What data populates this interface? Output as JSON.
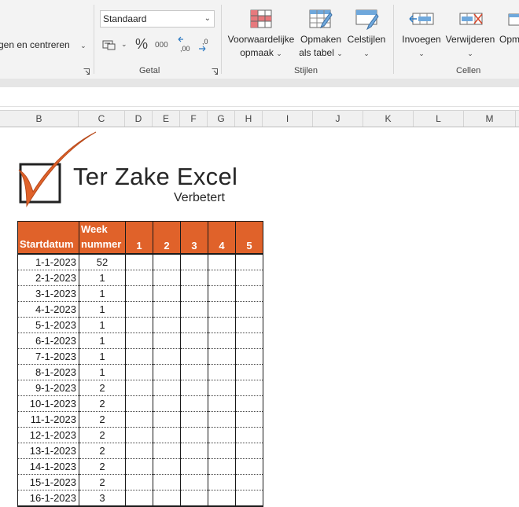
{
  "ribbon": {
    "alignment_partial_label": "gen en centreren",
    "number_format_value": "Standaard",
    "groups": {
      "getal": "Getal",
      "stijlen": "Stijlen",
      "cellen": "Cellen"
    },
    "buttons": {
      "voorwaardelijke_line1": "Voorwaardelijke",
      "voorwaardelijke_line2": "opmaak",
      "opmaken_line1": "Opmaken",
      "opmaken_line2": "als tabel",
      "celstijlen": "Celstijlen",
      "invoegen": "Invoegen",
      "verwijderen": "Verwijderen",
      "opmaak_partial": "Opm"
    },
    "number_symbols": {
      "percent": "%",
      "thousands": "000",
      "inc_decimal": ",00",
      "dec_decimal": ",0"
    }
  },
  "columns": [
    "B",
    "C",
    "D",
    "E",
    "F",
    "G",
    "H",
    "I",
    "J",
    "K",
    "L",
    "M"
  ],
  "logo": {
    "title": "Ter Zake Excel",
    "subtitle": "Verbetert"
  },
  "table": {
    "headers": {
      "startdatum": "Startdatum",
      "week_line1": "Week",
      "week_line2": "nummer",
      "days": [
        "1",
        "2",
        "3",
        "4",
        "5"
      ]
    },
    "rows": [
      {
        "date": "1-1-2023",
        "week": "52"
      },
      {
        "date": "2-1-2023",
        "week": "1"
      },
      {
        "date": "3-1-2023",
        "week": "1"
      },
      {
        "date": "4-1-2023",
        "week": "1"
      },
      {
        "date": "5-1-2023",
        "week": "1"
      },
      {
        "date": "6-1-2023",
        "week": "1"
      },
      {
        "date": "7-1-2023",
        "week": "1"
      },
      {
        "date": "8-1-2023",
        "week": "1"
      },
      {
        "date": "9-1-2023",
        "week": "2"
      },
      {
        "date": "10-1-2023",
        "week": "2"
      },
      {
        "date": "11-1-2023",
        "week": "2"
      },
      {
        "date": "12-1-2023",
        "week": "2"
      },
      {
        "date": "13-1-2023",
        "week": "2"
      },
      {
        "date": "14-1-2023",
        "week": "2"
      },
      {
        "date": "15-1-2023",
        "week": "2"
      },
      {
        "date": "16-1-2023",
        "week": "3"
      }
    ]
  },
  "colors": {
    "header_orange": "#e0622a",
    "logo_orange": "#e0622a"
  }
}
